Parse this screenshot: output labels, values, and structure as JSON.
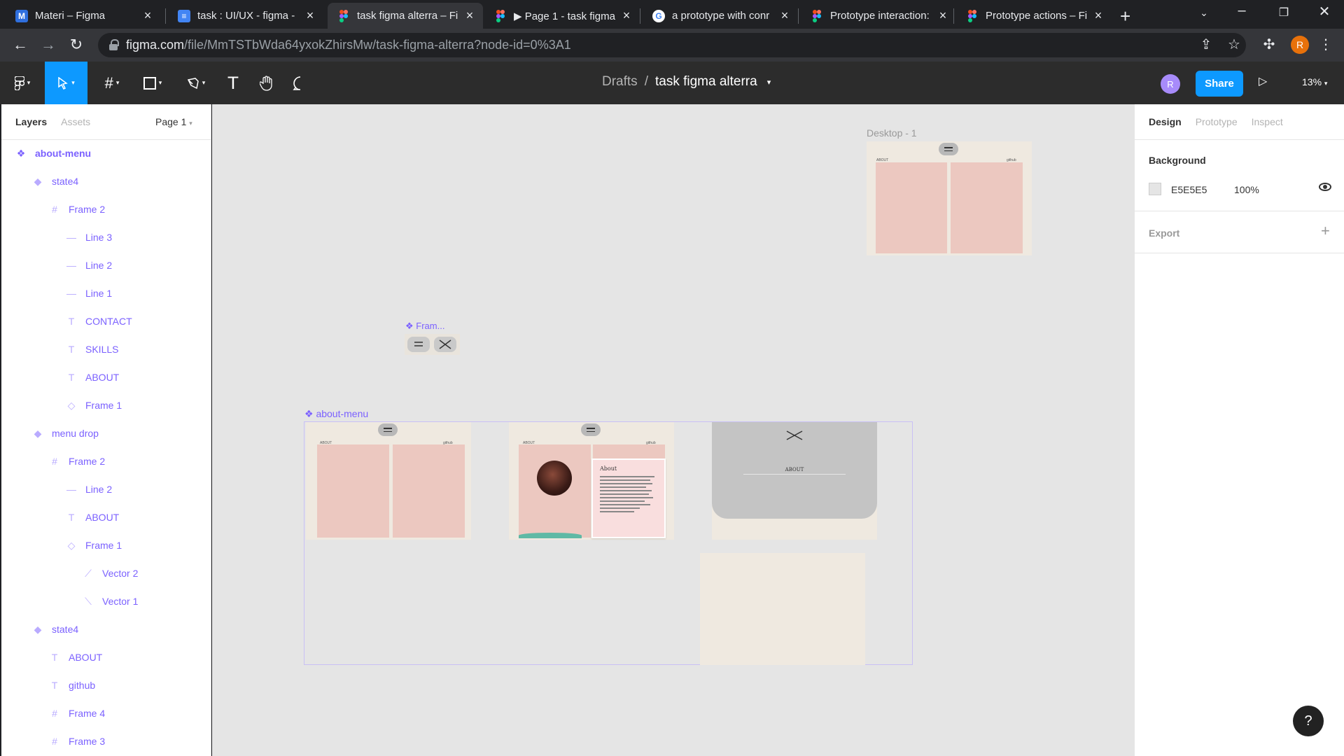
{
  "browser": {
    "tabs": [
      {
        "title": "Materi – Figma",
        "icon": "M",
        "color": "#2f6fde"
      },
      {
        "title": "task : UI/UX - figma -",
        "icon": "docs",
        "color": "#4285f4"
      },
      {
        "title": "task figma alterra – Fi",
        "icon": "figma",
        "color": "#f24e1e"
      },
      {
        "title": "▶ Page 1 - task figma",
        "icon": "figma",
        "color": "#f24e1e"
      },
      {
        "title": "a prototype with conr",
        "icon": "G",
        "color": "#4285f4"
      },
      {
        "title": "Prototype interaction:",
        "icon": "figma",
        "color": "#f24e1e"
      },
      {
        "title": "Prototype actions – Fi",
        "icon": "figma",
        "color": "#f24e1e"
      }
    ],
    "url_host": "figma.com",
    "url_path": "/file/MmTSTbWda64yxokZhirsMw/task-figma-alterra?node-id=0%3A1",
    "profile_initial": "R"
  },
  "figma": {
    "breadcrumb_root": "Drafts",
    "breadcrumb_sep": "/",
    "file_name": "task figma alterra",
    "avatar_initial": "R",
    "share_label": "Share",
    "zoom": "13%"
  },
  "left_panel": {
    "tabs": {
      "layers": "Layers",
      "assets": "Assets"
    },
    "page": "Page 1",
    "layers": [
      {
        "label": "about-menu",
        "icon": "component-set"
      },
      {
        "label": "state4",
        "icon": "variant"
      },
      {
        "label": "Frame 2",
        "icon": "frame"
      },
      {
        "label": "Line 3",
        "icon": "line"
      },
      {
        "label": "Line 2",
        "icon": "line"
      },
      {
        "label": "Line 1",
        "icon": "line"
      },
      {
        "label": "CONTACT",
        "icon": "text"
      },
      {
        "label": "SKILLS",
        "icon": "text"
      },
      {
        "label": "ABOUT",
        "icon": "text"
      },
      {
        "label": "Frame 1",
        "icon": "instance"
      },
      {
        "label": "menu drop",
        "icon": "variant"
      },
      {
        "label": "Frame 2",
        "icon": "frame"
      },
      {
        "label": "Line 2",
        "icon": "line"
      },
      {
        "label": "ABOUT",
        "icon": "text"
      },
      {
        "label": "Frame 1",
        "icon": "instance"
      },
      {
        "label": "Vector 2",
        "icon": "vector"
      },
      {
        "label": "Vector 1",
        "icon": "vector"
      },
      {
        "label": "state4",
        "icon": "variant"
      },
      {
        "label": "ABOUT",
        "icon": "text"
      },
      {
        "label": "github",
        "icon": "text"
      },
      {
        "label": "Frame 4",
        "icon": "frame"
      },
      {
        "label": "Frame 3",
        "icon": "frame"
      }
    ]
  },
  "canvas": {
    "desktop_label": "Desktop - 1",
    "frame_component_label": "Fram...",
    "about_menu_label": "about-menu",
    "mini_about": "ABOUT",
    "mini_github": "github",
    "card_heading": "About",
    "menu_about": "ABOUT"
  },
  "right_panel": {
    "tabs": {
      "design": "Design",
      "prototype": "Prototype",
      "inspect": "Inspect"
    },
    "background_title": "Background",
    "background_hex": "E5E5E5",
    "background_opacity": "100%",
    "export_title": "Export"
  },
  "help_label": "?"
}
